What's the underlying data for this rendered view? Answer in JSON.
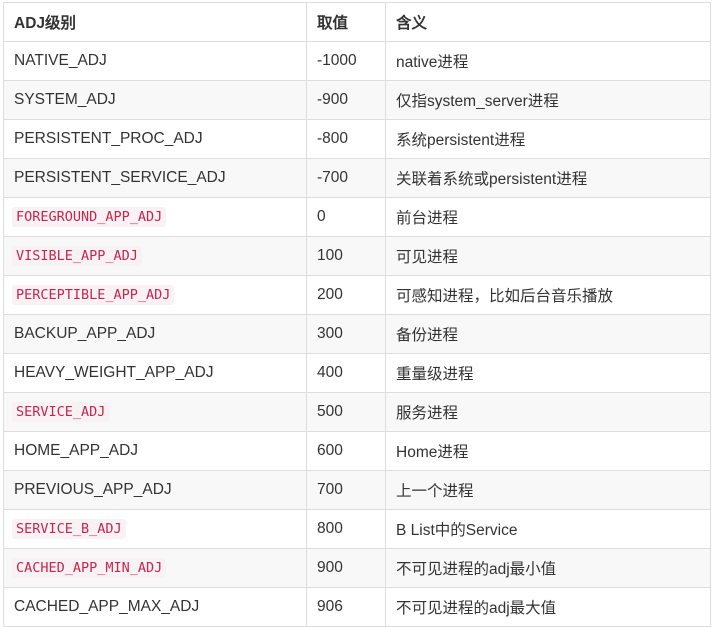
{
  "headers": [
    "ADJ级别",
    "取值",
    "含义"
  ],
  "rows": [
    {
      "name": "NATIVE_ADJ",
      "code": false,
      "value": "-1000",
      "meaning": "native进程"
    },
    {
      "name": "SYSTEM_ADJ",
      "code": false,
      "value": "-900",
      "meaning": "仅指system_server进程"
    },
    {
      "name": "PERSISTENT_PROC_ADJ",
      "code": false,
      "value": "-800",
      "meaning": "系统persistent进程"
    },
    {
      "name": "PERSISTENT_SERVICE_ADJ",
      "code": false,
      "value": "-700",
      "meaning": "关联着系统或persistent进程"
    },
    {
      "name": "FOREGROUND_APP_ADJ",
      "code": true,
      "value": "0",
      "meaning": "前台进程"
    },
    {
      "name": "VISIBLE_APP_ADJ",
      "code": true,
      "value": "100",
      "meaning": "可见进程"
    },
    {
      "name": "PERCEPTIBLE_APP_ADJ",
      "code": true,
      "value": "200",
      "meaning": "可感知进程，比如后台音乐播放"
    },
    {
      "name": "BACKUP_APP_ADJ",
      "code": false,
      "value": "300",
      "meaning": "备份进程"
    },
    {
      "name": "HEAVY_WEIGHT_APP_ADJ",
      "code": false,
      "value": "400",
      "meaning": "重量级进程"
    },
    {
      "name": "SERVICE_ADJ",
      "code": true,
      "value": "500",
      "meaning": "服务进程"
    },
    {
      "name": "HOME_APP_ADJ",
      "code": false,
      "value": "600",
      "meaning": "Home进程"
    },
    {
      "name": "PREVIOUS_APP_ADJ",
      "code": false,
      "value": "700",
      "meaning": "上一个进程"
    },
    {
      "name": "SERVICE_B_ADJ",
      "code": true,
      "value": "800",
      "meaning": "B List中的Service"
    },
    {
      "name": "CACHED_APP_MIN_ADJ",
      "code": true,
      "value": "900",
      "meaning": "不可见进程的adj最小值"
    },
    {
      "name": "CACHED_APP_MAX_ADJ",
      "code": false,
      "value": "906",
      "meaning": "不可见进程的adj最大值"
    }
  ]
}
